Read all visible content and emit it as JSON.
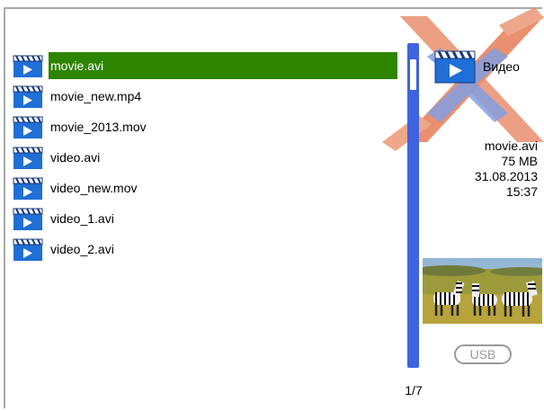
{
  "files": [
    {
      "name": "movie.avi",
      "selected": true
    },
    {
      "name": "movie_new.mp4",
      "selected": false
    },
    {
      "name": "movie_2013.mov",
      "selected": false
    },
    {
      "name": "video.avi",
      "selected": false
    },
    {
      "name": "video_new.mov",
      "selected": false
    },
    {
      "name": "video_1.avi",
      "selected": false
    },
    {
      "name": "video_2.avi",
      "selected": false
    }
  ],
  "pagination": {
    "label": "1/7"
  },
  "category": {
    "label": "Видео",
    "icon": "clapperboard-icon"
  },
  "details": {
    "filename": "movie.avi",
    "size": "75 MB",
    "date": "31.08.2013",
    "time": "15:37"
  },
  "preview": {
    "icon": "zebras-thumbnail"
  },
  "source": {
    "label": "USB"
  },
  "colors": {
    "selection": "#2e8500",
    "scrollbar": "#3d63e0",
    "accent_orange": "#e5643a",
    "accent_blue": "#5b7fd8"
  }
}
